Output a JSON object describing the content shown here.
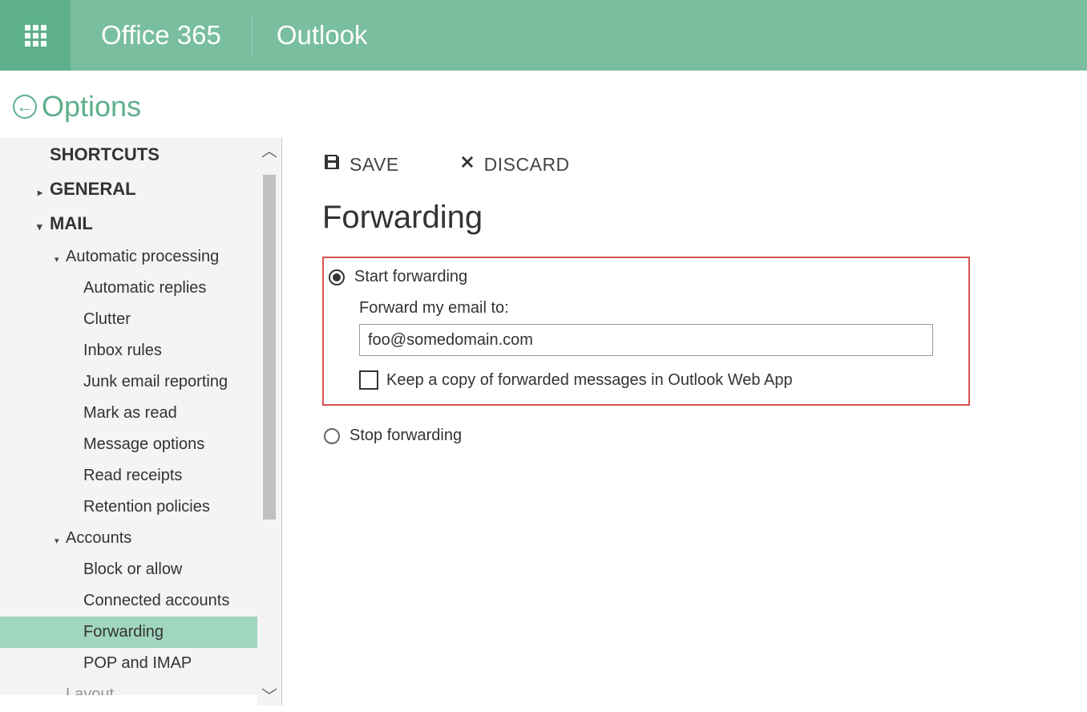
{
  "header": {
    "suite": "Office 365",
    "app": "Outlook"
  },
  "options_label": "Options",
  "toolbar": {
    "save": "SAVE",
    "discard": "DISCARD"
  },
  "nav": {
    "shortcuts": "SHORTCUTS",
    "general": "GENERAL",
    "mail": "MAIL",
    "automatic_processing": "Automatic processing",
    "automatic_replies": "Automatic replies",
    "clutter": "Clutter",
    "inbox_rules": "Inbox rules",
    "junk_email_reporting": "Junk email reporting",
    "mark_as_read": "Mark as read",
    "message_options": "Message options",
    "read_receipts": "Read receipts",
    "retention_policies": "Retention policies",
    "accounts": "Accounts",
    "block_or_allow": "Block or allow",
    "connected_accounts": "Connected accounts",
    "forwarding": "Forwarding",
    "pop_and_imap": "POP and IMAP",
    "layout": "Layout"
  },
  "page": {
    "title": "Forwarding",
    "start_forwarding": "Start forwarding",
    "forward_label": "Forward my email to:",
    "forward_value": "foo@somedomain.com",
    "keep_copy": "Keep a copy of forwarded messages in Outlook Web App",
    "stop_forwarding": "Stop forwarding"
  }
}
